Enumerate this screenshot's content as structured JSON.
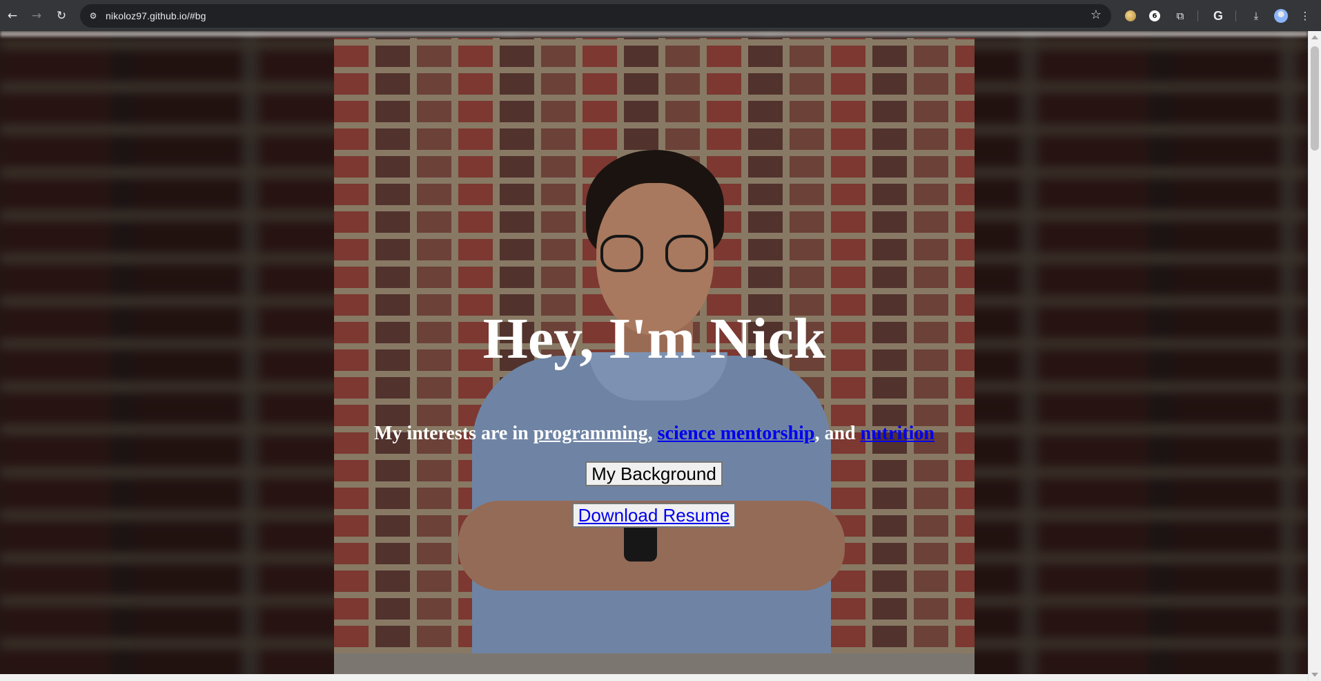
{
  "browser": {
    "url": "nikoloz97.github.io/#bg",
    "icons": {
      "back": "arrow-left-icon",
      "forward": "arrow-right-icon",
      "reload": "reload-icon",
      "site_info": "tune-icon",
      "bookmark": "star-icon",
      "extensions": "puzzle-icon",
      "google": "google-icon",
      "downloads": "download-icon",
      "profile": "avatar-icon",
      "menu": "kebab-menu-icon"
    },
    "glyphs": {
      "back": "←",
      "forward": "→",
      "reload": "↻",
      "site_info": "⚙",
      "bookmark": "☆",
      "extensions": "⧉",
      "google": "G",
      "downloads": "⤓",
      "menu": "⋮",
      "ext2": "6"
    }
  },
  "hero": {
    "title": "Hey, I'm Nick",
    "tagline_prefix": "My interests are in ",
    "link_programming": "programming",
    "sep1": ", ",
    "link_mentorship": "science mentorship",
    "sep2": ", and ",
    "link_nutrition": "nutrition"
  },
  "buttons": {
    "background": "My Background",
    "resume": "Download Resume"
  },
  "colors": {
    "link_blue": "#0000ee",
    "chrome_bg": "#35363a",
    "omnibox_bg": "#202124",
    "text_white": "#ffffff"
  }
}
